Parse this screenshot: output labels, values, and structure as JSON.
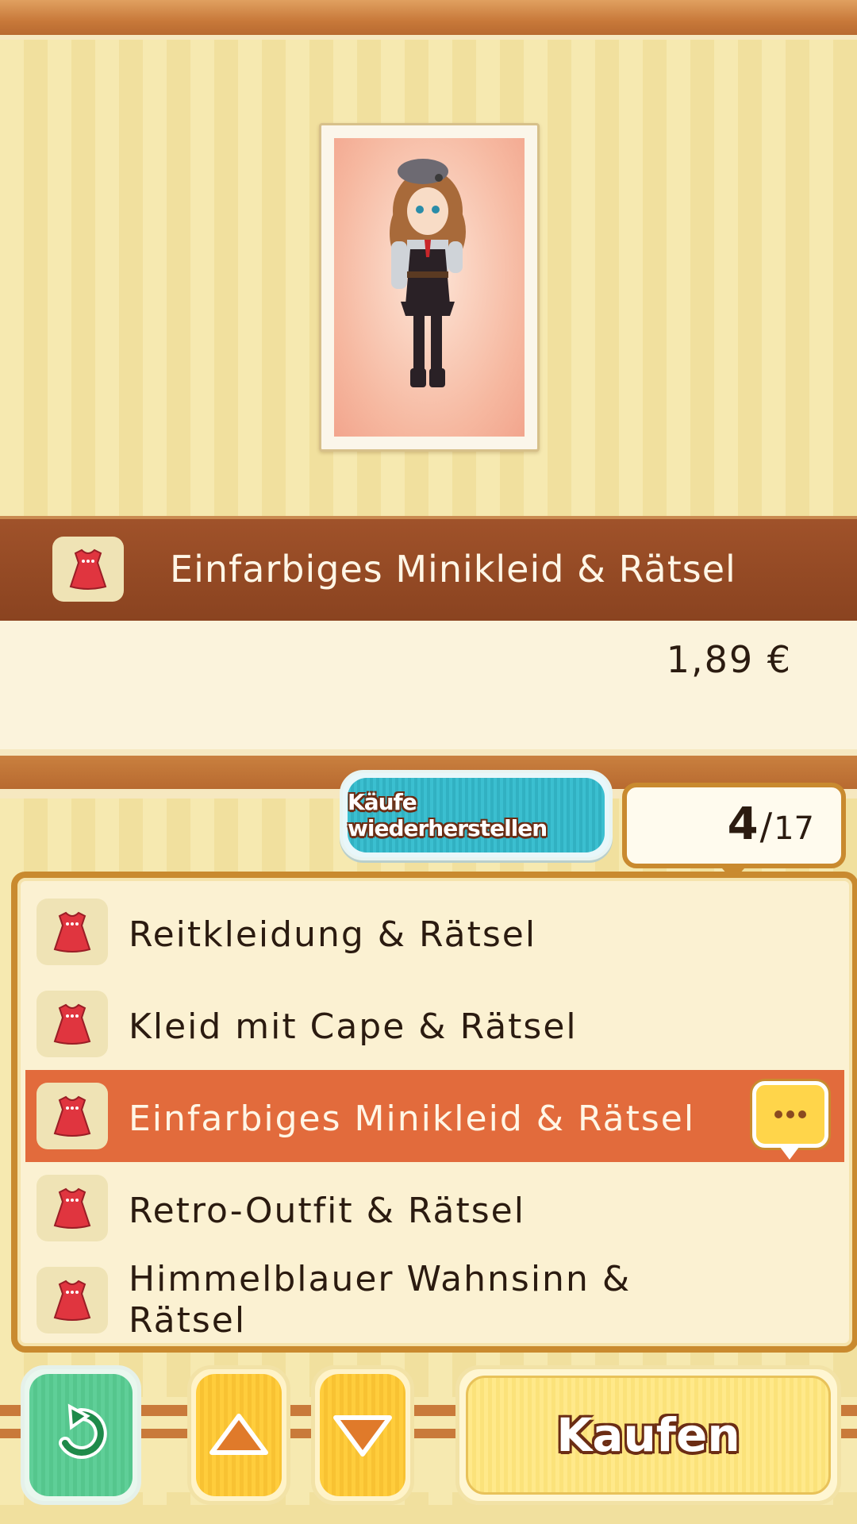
{
  "preview": {
    "icon": "character-outfit-portrait"
  },
  "selected_item": {
    "title": "Einfarbiges Minikleid & Rätsel",
    "price": "1,89 €",
    "icon": "dress-icon"
  },
  "restore_button": {
    "label": "Käufe wiederherstellen"
  },
  "counter": {
    "current": "4",
    "separator": "/",
    "total": "17"
  },
  "list": {
    "items": [
      {
        "label": "Reitkleidung & Rätsel",
        "icon": "dress-icon",
        "selected": false
      },
      {
        "label": "Kleid mit Cape & Rätsel",
        "icon": "dress-icon",
        "selected": false
      },
      {
        "label": "Einfarbiges Minikleid & Rätsel",
        "icon": "dress-icon",
        "selected": true,
        "badge": "chat-bubble-icon"
      },
      {
        "label": "Retro-Outfit & Rätsel",
        "icon": "dress-icon",
        "selected": false
      },
      {
        "label": "Himmelblauer Wahnsinn & Rätsel",
        "icon": "dress-icon",
        "selected": false
      }
    ]
  },
  "buttons": {
    "back": {
      "icon": "back-arrow-icon"
    },
    "up": {
      "icon": "triangle-up-icon"
    },
    "down": {
      "icon": "triangle-down-icon"
    },
    "buy": {
      "label": "Kaufen"
    }
  },
  "colors": {
    "banner": "#8a4320",
    "selected_row": "#e26b3c",
    "restore_button": "#3bbfd0",
    "back_button": "#5fcf98",
    "arrow_button": "#ffcd3c",
    "buy_button": "#ffe98a"
  }
}
